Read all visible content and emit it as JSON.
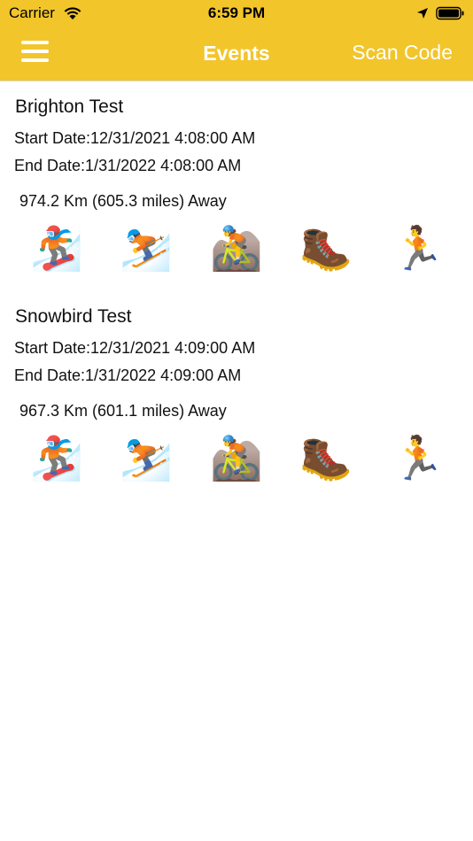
{
  "status_bar": {
    "carrier": "Carrier",
    "time": "6:59 PM"
  },
  "nav": {
    "title": "Events",
    "scan_label": "Scan Code"
  },
  "colors": {
    "accent": "#f2c52b",
    "nav_text": "#ffffff"
  },
  "events": [
    {
      "title": "Brighton Test",
      "start": "Start Date:12/31/2021 4:08:00 AM",
      "end": "End Date:1/31/2022 4:08:00 AM",
      "distance": "974.2 Km (605.3 miles) Away",
      "activities": [
        {
          "name": "snowboard-icon",
          "glyph": "🏂"
        },
        {
          "name": "ski-icon",
          "glyph": "⛷️"
        },
        {
          "name": "mountain-bike-icon",
          "glyph": "🚵"
        },
        {
          "name": "hiking-boot-icon",
          "glyph": "🥾"
        },
        {
          "name": "runner-icon",
          "glyph": "🏃"
        }
      ]
    },
    {
      "title": "Snowbird Test",
      "start": "Start Date:12/31/2021 4:09:00 AM",
      "end": "End Date:1/31/2022 4:09:00 AM",
      "distance": "967.3 Km (601.1 miles) Away",
      "activities": [
        {
          "name": "snowboard-icon",
          "glyph": "🏂"
        },
        {
          "name": "ski-icon",
          "glyph": "⛷️"
        },
        {
          "name": "mountain-bike-icon",
          "glyph": "🚵"
        },
        {
          "name": "hiking-boot-icon",
          "glyph": "🥾"
        },
        {
          "name": "runner-icon",
          "glyph": "🏃"
        }
      ]
    }
  ]
}
